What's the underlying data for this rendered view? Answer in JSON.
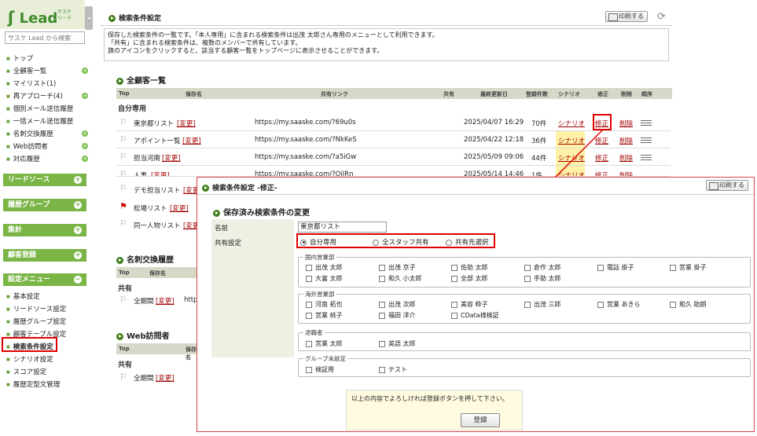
{
  "sidebar": {
    "logo_text": "Lead",
    "logo_sub": "サスケ リード",
    "collapse_icon": "◂",
    "search_placeholder": "サスケ Lead から検索",
    "nav_items": [
      {
        "label": "トップ"
      },
      {
        "label": "全顧客一覧"
      },
      {
        "label": "マイリスト(1)"
      },
      {
        "label": "再アプローチ(4)"
      },
      {
        "label": "個別メール送信履歴"
      },
      {
        "label": "一括メール送信履歴"
      },
      {
        "label": "名刺交換履歴"
      },
      {
        "label": "Web訪問者"
      },
      {
        "label": "対応履歴"
      }
    ],
    "sections": [
      "リードソース",
      "履歴グループ",
      "集計",
      "顧客登録",
      "設定メニュー"
    ],
    "settings_items": [
      {
        "label": "基本設定"
      },
      {
        "label": "リードソース設定"
      },
      {
        "label": "履歴グループ設定"
      },
      {
        "label": "顧客テーブル設定"
      },
      {
        "label": "検索条件設定"
      },
      {
        "label": "シナリオ設定"
      },
      {
        "label": "スコア設定"
      },
      {
        "label": "履歴定型文管理"
      }
    ]
  },
  "header": {
    "title": "検索条件設定",
    "print_label": "印刷する",
    "refresh_icon": "⟳"
  },
  "description": [
    "保存した検索条件の一覧です。「本人専用」に含まれる検索条件は出茂 太郎さん専用のメニューとして利用できます。",
    "「共有」に含まれる検索条件は、複数のメンバーで共有しています。",
    "旗のアイコンをクリックすると、該当する顧客一覧をトップページに表示させることができます。"
  ],
  "all_customers": {
    "title": "全顧客一覧",
    "columns": [
      "Top",
      "保存名",
      "共有リンク",
      "共有",
      "最終更新日",
      "登録件数",
      "シナリオ",
      "修正",
      "削除",
      "順序"
    ],
    "group": "自分専用",
    "rows": [
      {
        "name": "東京都リスト",
        "edit": "[変更]",
        "link": "https://my.saaske.com/?69u0s",
        "date": "2025/04/07 16:29",
        "count": "70件",
        "scenario": "シナリオ",
        "fix": "修正",
        "del": "削除"
      },
      {
        "name": "アポイント一覧",
        "edit": "[変更]",
        "link": "https://my.saaske.com/?NkKeS",
        "date": "2025/04/22 12:18",
        "count": "36件",
        "scenario": "シナリオ",
        "fix": "修正",
        "del": "削除"
      },
      {
        "name": "担当河南",
        "edit": "[変更]",
        "link": "https://my.saaske.com/?a5iGw",
        "date": "2025/05/09 09:06",
        "count": "44件",
        "scenario": "シナリオ",
        "fix": "修正",
        "del": "削除"
      },
      {
        "name": "人事",
        "edit": "[変更]",
        "link": "https://my.saaske.com/?OjJRn",
        "date": "2025/05/14 14:46",
        "count": "1件",
        "scenario": "シナリオ",
        "fix": "修正",
        "del": "削除"
      }
    ],
    "partial_rows": [
      {
        "name": "デモ担当リスト",
        "edit": "[変更"
      },
      {
        "name": "松場リスト",
        "edit": "[変更]"
      },
      {
        "name": "同一人物リスト",
        "edit": "[変更"
      }
    ]
  },
  "card_exchange": {
    "title": "名刺交換履歴",
    "columns": [
      "Top",
      "保存名"
    ],
    "group": "共有",
    "row_name": "全期間",
    "row_edit": "[変更]",
    "row_link": "http"
  },
  "web_visitors": {
    "title": "Web訪問者",
    "columns": [
      "Top",
      "保存名"
    ],
    "group": "共有",
    "row_name": "全期間",
    "row_edit": "[変更]"
  },
  "modal": {
    "title": "検索条件設定 -修正-",
    "print_label": "印刷する",
    "section_title": "保存済み検索条件の変更",
    "name_label": "名前",
    "name_value": "東京都リスト",
    "share_label": "共有設定",
    "share_options": [
      "自分専用",
      "全スタッフ共有",
      "共有先選択"
    ],
    "groups": [
      {
        "legend": "国内営業部",
        "members": [
          "出茂 太郎",
          "出茂 京子",
          "佐助 太郎",
          "倉作 太郎",
          "電話 掛子",
          "営業 掛子",
          "大富 太郎",
          "和久 小太郎",
          "全部 太郎",
          "手助 太郎"
        ]
      },
      {
        "legend": "海外営業部",
        "members": [
          "河南 拓也",
          "出茂 次郎",
          "美容 粋子",
          "出茂 三郎",
          "営業 あきら",
          "和久 助朗",
          "営業 桃子",
          "福田 洋介",
          "CData様検証"
        ]
      },
      {
        "legend": "退職者",
        "members": [
          "営業 太郎",
          "英語 太郎"
        ]
      },
      {
        "legend": "グループ未設定",
        "members": [
          "検証用",
          "テスト"
        ]
      }
    ],
    "confirm_message": "以上の内容でよろしければ登録ボタンを押して下さい。",
    "submit_label": "登録"
  }
}
